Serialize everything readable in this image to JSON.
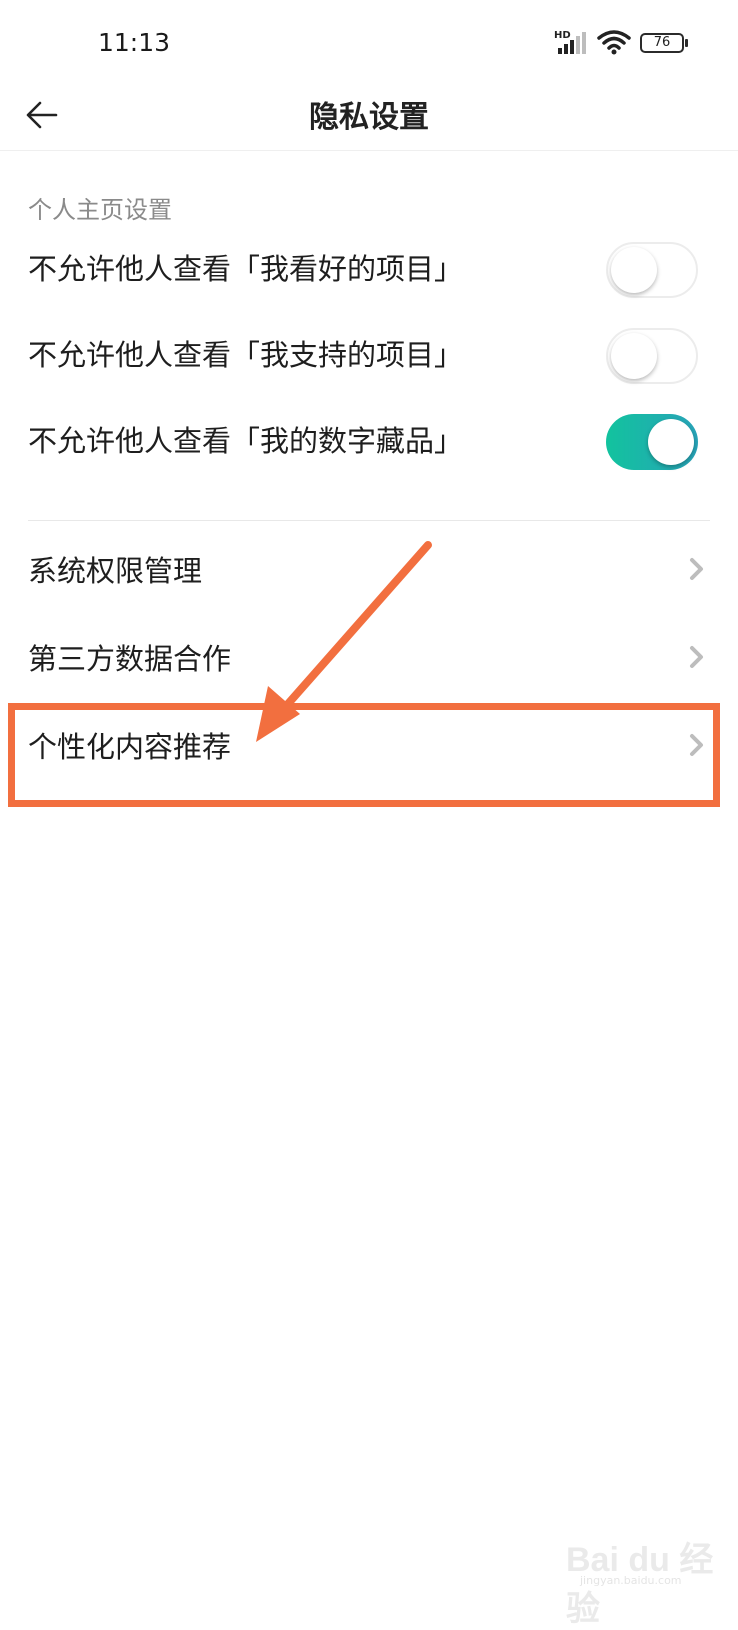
{
  "status_bar": {
    "time": "11:13",
    "network": "HD",
    "battery": "76"
  },
  "header": {
    "title": "隐私设置"
  },
  "profile_section": {
    "label": "个人主页设置",
    "toggles": [
      {
        "label": "不允许他人查看「我看好的项目」",
        "on": false
      },
      {
        "label": "不允许他人查看「我支持的项目」",
        "on": false
      },
      {
        "label": "不允许他人查看「我的数字藏品」",
        "on": true
      }
    ]
  },
  "menu_items": [
    {
      "label": "系统权限管理"
    },
    {
      "label": "第三方数据合作"
    },
    {
      "label": "个性化内容推荐"
    }
  ],
  "annotation_color": "#f26f3f",
  "toggle_on_colors": [
    "#12c39e",
    "#28a3b8"
  ],
  "watermark": {
    "text": "Bai du 经验",
    "sub": "jingyan.baidu.com"
  }
}
